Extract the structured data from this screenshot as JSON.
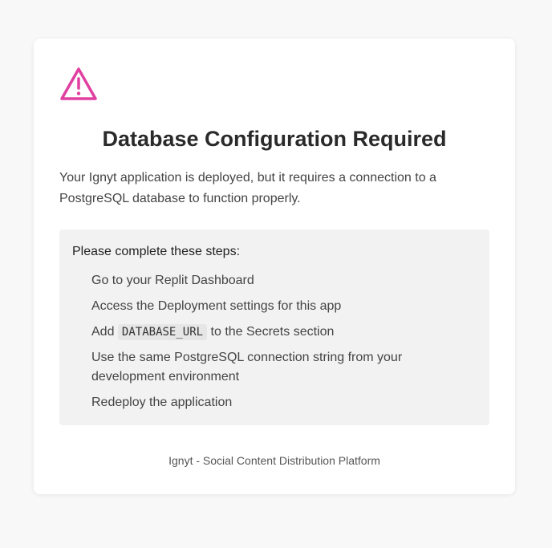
{
  "colors": {
    "warning_accent": "#e040a0",
    "page_background": "#f8f8f8",
    "card_background": "#ffffff",
    "steps_background": "#f2f2f2"
  },
  "icon": "warning-triangle-icon",
  "title": "Database Configuration Required",
  "intro": "Your Ignyt application is deployed, but it requires a connection to a PostgreSQL database to function properly.",
  "steps": {
    "heading": "Please complete these steps:",
    "items": [
      {
        "text": "Go to your Replit Dashboard"
      },
      {
        "text": "Access the Deployment settings for this app"
      },
      {
        "before": "Add",
        "code": "DATABASE_URL",
        "after": "to the Secrets section"
      },
      {
        "text": "Use the same PostgreSQL connection string from your development environment"
      },
      {
        "text": "Redeploy the application"
      }
    ]
  },
  "footer": "Ignyt - Social Content Distribution Platform"
}
